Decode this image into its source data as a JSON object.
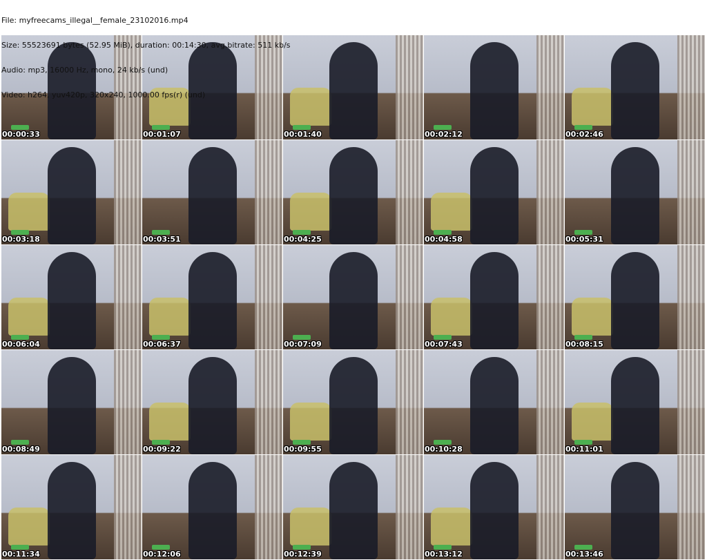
{
  "header": {
    "file": "File: myfreecams_illegal__female_23102016.mp4",
    "size": "Size: 55523691 bytes (52.95 MiB), duration: 00:14:30, avg.bitrate: 511 kb/s",
    "audio": "Audio: mp3, 16000 Hz, mono, 24 kb/s (und)",
    "video": "Video: h264, yuv420p, 320x240, 1000.00 fps(r) (und)"
  },
  "thumbnails": [
    {
      "time": "00:00:33"
    },
    {
      "time": "00:01:07"
    },
    {
      "time": "00:01:40"
    },
    {
      "time": "00:02:12"
    },
    {
      "time": "00:02:46"
    },
    {
      "time": "00:03:18"
    },
    {
      "time": "00:03:51"
    },
    {
      "time": "00:04:25"
    },
    {
      "time": "00:04:58"
    },
    {
      "time": "00:05:31"
    },
    {
      "time": "00:06:04"
    },
    {
      "time": "00:06:37"
    },
    {
      "time": "00:07:09"
    },
    {
      "time": "00:07:43"
    },
    {
      "time": "00:08:15"
    },
    {
      "time": "00:08:49"
    },
    {
      "time": "00:09:22"
    },
    {
      "time": "00:09:55"
    },
    {
      "time": "00:10:28"
    },
    {
      "time": "00:11:01"
    },
    {
      "time": "00:11:34"
    },
    {
      "time": "00:12:06"
    },
    {
      "time": "00:12:39"
    },
    {
      "time": "00:13:12"
    },
    {
      "time": "00:13:46"
    }
  ]
}
